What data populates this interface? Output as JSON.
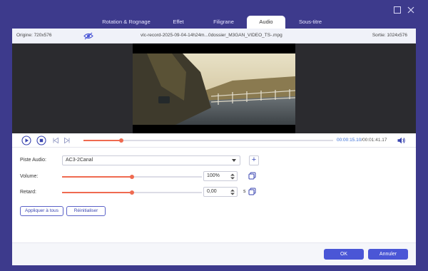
{
  "tabs": [
    {
      "label": "Rotation & Rognage",
      "active": false
    },
    {
      "label": "Effet",
      "active": false
    },
    {
      "label": "Filigrane",
      "active": false
    },
    {
      "label": "Audio",
      "active": true
    },
    {
      "label": "Sous-titre",
      "active": false
    }
  ],
  "infobar": {
    "origin": "Origine: 720x576",
    "filename": "vlc-record-2025-09-04-14h24m...0dossier_M3GAN_VIDEO_TS-.mpg",
    "output": "Sortie: 1024x576"
  },
  "playback": {
    "current_time": "00:00:15.10",
    "total_time": "/00:01:41.17",
    "progress_fraction": 0.15
  },
  "audio": {
    "track_label": "Piste Audio:",
    "track_value": "AC3-2Canal",
    "volume_label": "Volume:",
    "volume_value": "100%",
    "volume_fraction": 0.5,
    "delay_label": "Retard:",
    "delay_value": "0,00",
    "delay_unit": "s",
    "delay_fraction": 0.5
  },
  "actions": {
    "apply_all": "Appliquer à tous",
    "reset": "Réinitialiser",
    "ok": "OK",
    "cancel": "Annuler"
  },
  "colors": {
    "accent": "#ef6a50",
    "primary": "#4a56d6",
    "frame": "#3d3a8c"
  },
  "icons": [
    "eye-icon",
    "play-icon",
    "stop-icon",
    "skip-back-icon",
    "skip-forward-icon",
    "speaker-icon",
    "plus-icon",
    "copy-apply-icon",
    "minimize-icon",
    "close-icon"
  ]
}
